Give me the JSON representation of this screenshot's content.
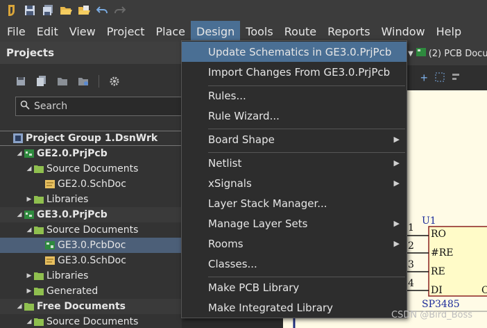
{
  "menubar": {
    "items": [
      "File",
      "Edit",
      "View",
      "Project",
      "Place",
      "Design",
      "Tools",
      "Route",
      "Reports",
      "Window",
      "Help"
    ],
    "active": "Design"
  },
  "projects": {
    "title": "Projects",
    "search_placeholder": "Search",
    "tree": [
      {
        "label": "Project Group 1.DsnWrk",
        "bold": true
      },
      {
        "label": "GE2.0.PrjPcb",
        "bold": true
      },
      {
        "label": "Source Documents"
      },
      {
        "label": "GE2.0.SchDoc"
      },
      {
        "label": "Libraries"
      },
      {
        "label": "GE3.0.PrjPcb",
        "bold": true
      },
      {
        "label": "Source Documents"
      },
      {
        "label": "GE3.0.PcbDoc"
      },
      {
        "label": "GE3.0.SchDoc"
      },
      {
        "label": "Libraries"
      },
      {
        "label": "Generated"
      },
      {
        "label": "Free Documents",
        "bold": true
      },
      {
        "label": "Source Documents"
      }
    ]
  },
  "design_menu": {
    "items": [
      {
        "label": "Update Schematics in GE3.0.PrjPcb",
        "highlighted": true
      },
      {
        "label": "Import Changes From GE3.0.PrjPcb"
      },
      {
        "label": "Rules..."
      },
      {
        "label": "Rule Wizard..."
      },
      {
        "label": "Board Shape",
        "submenu": true
      },
      {
        "label": "Netlist",
        "submenu": true
      },
      {
        "label": "xSignals",
        "submenu": true
      },
      {
        "label": "Layer Stack Manager..."
      },
      {
        "label": "Manage Layer Sets",
        "submenu": true
      },
      {
        "label": "Rooms",
        "submenu": true
      },
      {
        "label": "Classes..."
      },
      {
        "label": "Make PCB Library"
      },
      {
        "label": "Make Integrated Library"
      }
    ]
  },
  "document_tab": {
    "label": "(2) PCB Docu"
  },
  "schematic": {
    "designator": "U1",
    "part": "SP3485",
    "pins": [
      {
        "num": "1",
        "name": "RO"
      },
      {
        "num": "2",
        "name": "#RE"
      },
      {
        "num": "3",
        "name": "RE"
      },
      {
        "num": "4",
        "name": "DI"
      }
    ],
    "right_char": "C"
  },
  "watermark": "CSDN @Bird_Boss",
  "colors": {
    "menu_highlight": "#4a6f94",
    "tree_selected": "#4c5f78",
    "folder": "#8fbf4f",
    "sheet": "#fffbe6"
  }
}
